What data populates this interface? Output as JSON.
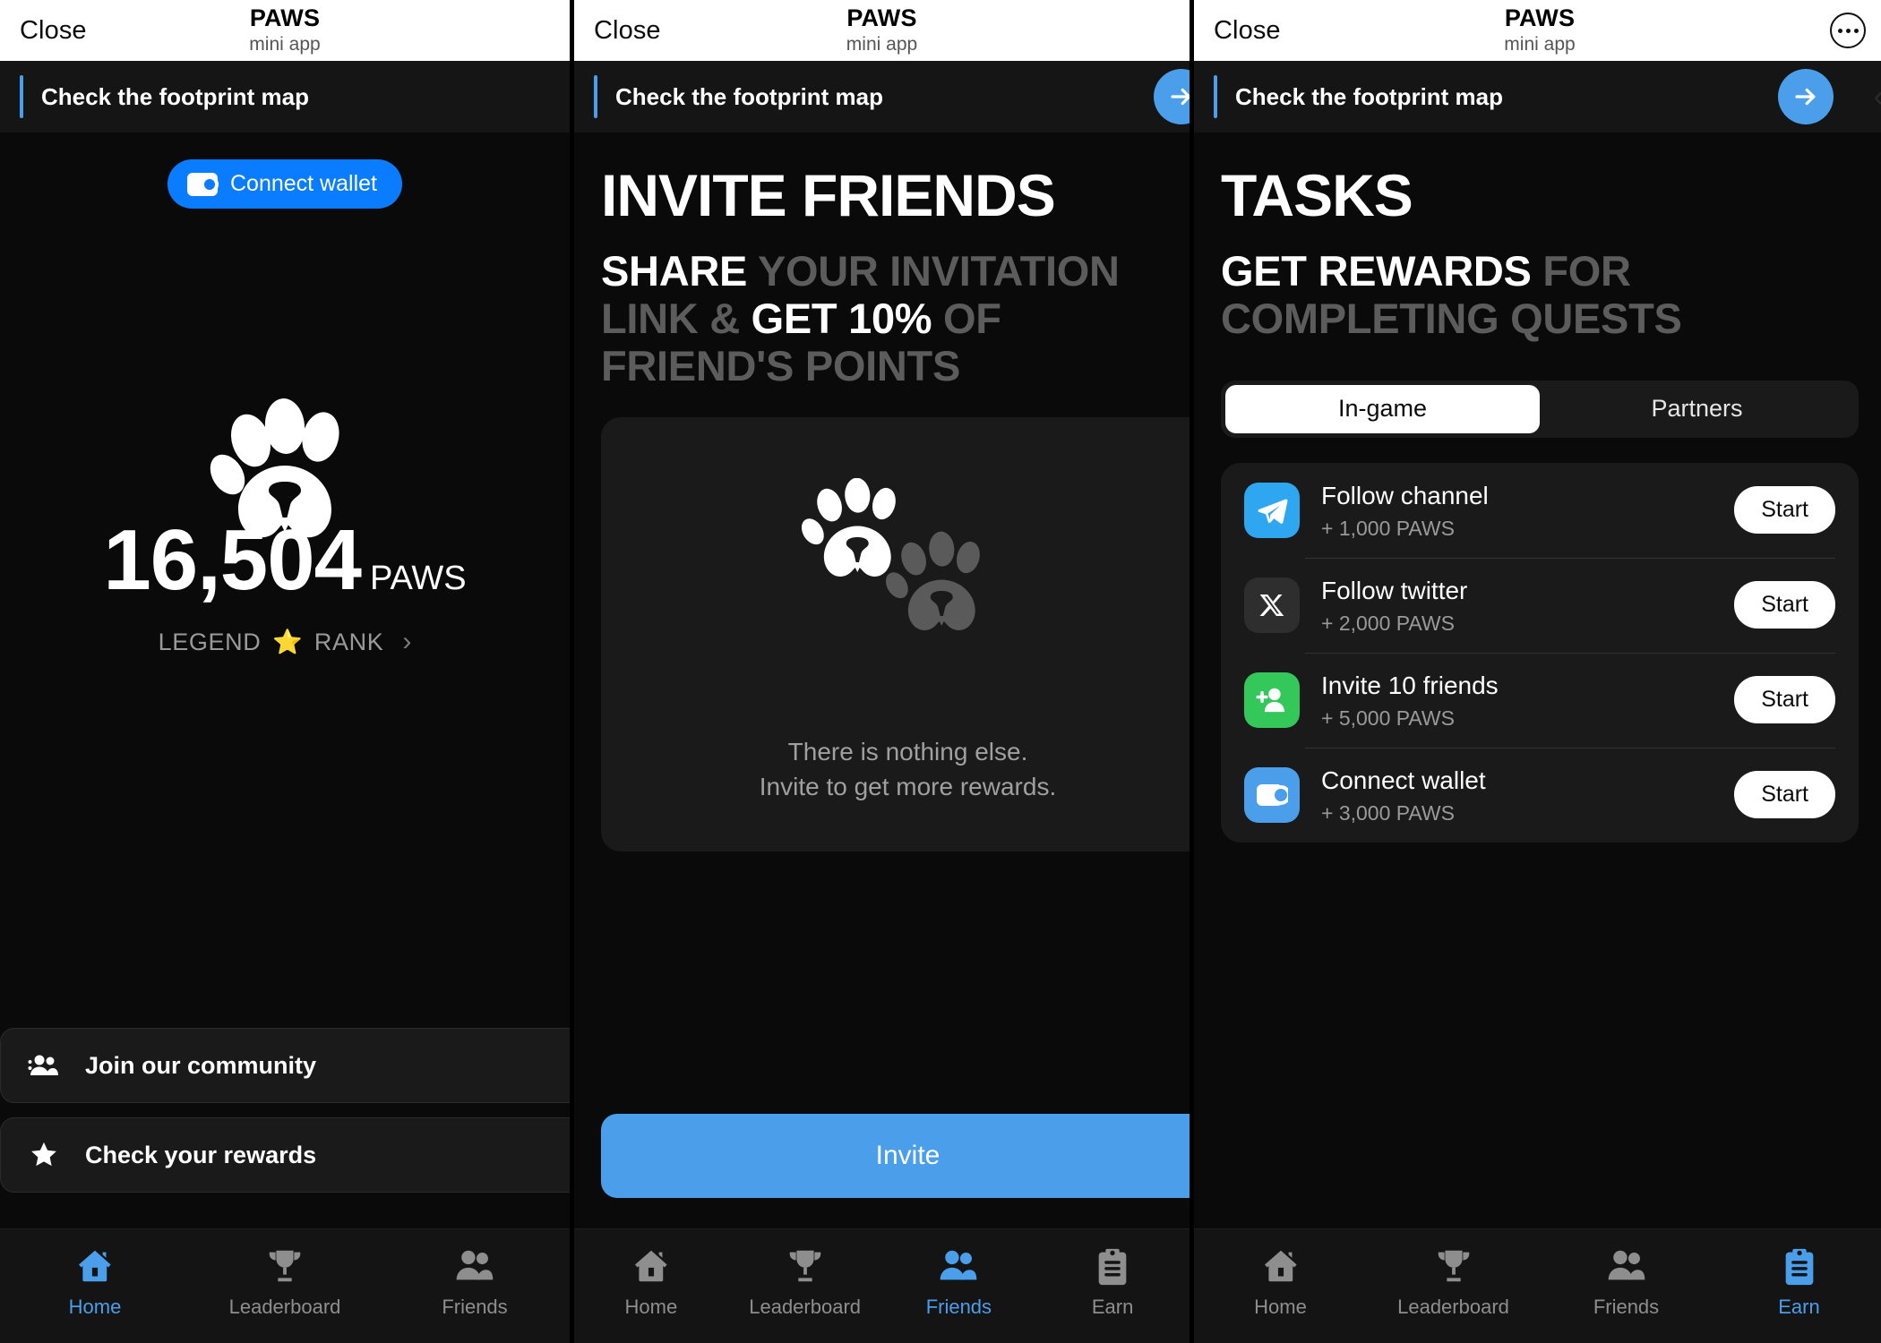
{
  "app": {
    "close_label": "Close",
    "title": "PAWS",
    "subtitle": "mini app",
    "more_icon": "ellipsis-icon",
    "accent_blue": "#4a9eea",
    "button_blue": "#0a7cff",
    "background": "#0a0a0a",
    "card_background": "#1a1a1a"
  },
  "banner": {
    "text": "Check the footprint map",
    "accent_color": "#4a9eea",
    "arrow_icon": "arrow-right-icon"
  },
  "home": {
    "connect_wallet_label": "Connect wallet",
    "wallet_icon": "wallet-icon",
    "logo_icon": "paw-logo-icon",
    "score_value": "16,504",
    "score_unit": "PAWS",
    "rank_prefix": "LEGEND",
    "rank_star": "⭐",
    "rank_suffix": "RANK",
    "rank_chevron": "chevron-right-icon",
    "cta": [
      {
        "label": "Join our community",
        "icon": "people-group-icon"
      },
      {
        "label": "Check your rewards",
        "icon": "star-icon"
      }
    ]
  },
  "friends": {
    "heading": "INVITE FRIENDS",
    "sub_parts": [
      {
        "text": "SHARE",
        "highlight": true
      },
      {
        "text": " YOUR INVITATION LINK & ",
        "highlight": false
      },
      {
        "text": "GET 10%",
        "highlight": true
      },
      {
        "text": " OF FRIEND'S POINTS",
        "highlight": false
      }
    ],
    "empty_icon": "double-paw-icon",
    "empty_line1": "There is nothing else.",
    "empty_line2": "Invite to get more rewards.",
    "invite_button_label": "Invite"
  },
  "earn": {
    "heading": "TASKS",
    "sub_parts": [
      {
        "text": "GET REWARDS",
        "highlight": true
      },
      {
        "text": " FOR COMPLETING QUESTS",
        "highlight": false
      }
    ],
    "tabs": [
      {
        "label": "In-game",
        "active": true
      },
      {
        "label": "Partners",
        "active": false
      }
    ],
    "tasks": [
      {
        "title": "Follow channel",
        "reward": "+ 1,000 PAWS",
        "action": "Start",
        "icon": "telegram-icon",
        "icon_bg": "#2ea6f0"
      },
      {
        "title": "Follow twitter",
        "reward": "+ 2,000 PAWS",
        "action": "Start",
        "icon": "x-twitter-icon",
        "icon_bg": "#2e2e2e"
      },
      {
        "title": "Invite 10 friends",
        "reward": "+ 5,000 PAWS",
        "action": "Start",
        "icon": "add-friends-icon",
        "icon_bg": "#34c759"
      },
      {
        "title": "Connect wallet",
        "reward": "+ 3,000 PAWS",
        "action": "Start",
        "icon": "wallet-icon",
        "icon_bg": "#4a9eea"
      }
    ]
  },
  "nav": {
    "panel1": [
      {
        "label": "Home",
        "icon": "home-icon",
        "active": true
      },
      {
        "label": "Leaderboard",
        "icon": "trophy-icon",
        "active": false
      },
      {
        "label": "Friends",
        "icon": "people-icon",
        "active": false
      }
    ],
    "panel2": [
      {
        "label": "Home",
        "icon": "home-icon",
        "active": false
      },
      {
        "label": "Leaderboard",
        "icon": "trophy-icon",
        "active": false
      },
      {
        "label": "Friends",
        "icon": "people-icon",
        "active": true
      },
      {
        "label": "Earn",
        "icon": "clipboard-icon",
        "active": false
      }
    ],
    "panel3": [
      {
        "label": "Home",
        "icon": "home-icon",
        "active": false
      },
      {
        "label": "Leaderboard",
        "icon": "trophy-icon",
        "active": false
      },
      {
        "label": "Friends",
        "icon": "people-icon",
        "active": false
      },
      {
        "label": "Earn",
        "icon": "clipboard-icon",
        "active": true
      }
    ]
  }
}
